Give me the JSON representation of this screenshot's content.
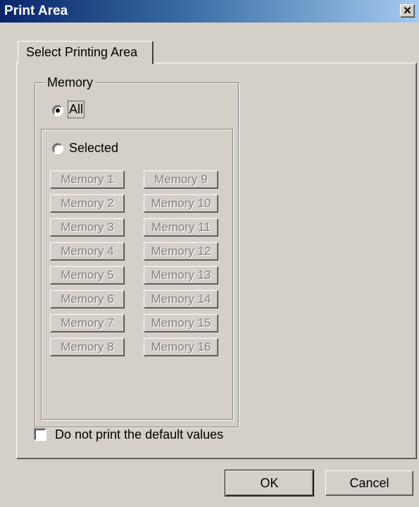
{
  "window": {
    "title": "Print Area",
    "close_label": "✕"
  },
  "tabs": [
    {
      "label": "Select Printing Area"
    }
  ],
  "memory_group": {
    "label": "Memory",
    "all_option": {
      "label": "All",
      "checked": true
    },
    "selected_option": {
      "label": "Selected",
      "checked": false
    },
    "memory_buttons": [
      "Memory 1",
      "Memory 2",
      "Memory 3",
      "Memory 4",
      "Memory 5",
      "Memory 6",
      "Memory 7",
      "Memory 8",
      "Memory 9",
      "Memory 10",
      "Memory 11",
      "Memory 12",
      "Memory 13",
      "Memory 14",
      "Memory 15",
      "Memory 16"
    ]
  },
  "options": {
    "no_default_values": {
      "label": "Do not print the default values",
      "checked": false
    }
  },
  "buttons": {
    "ok": "OK",
    "cancel": "Cancel"
  }
}
